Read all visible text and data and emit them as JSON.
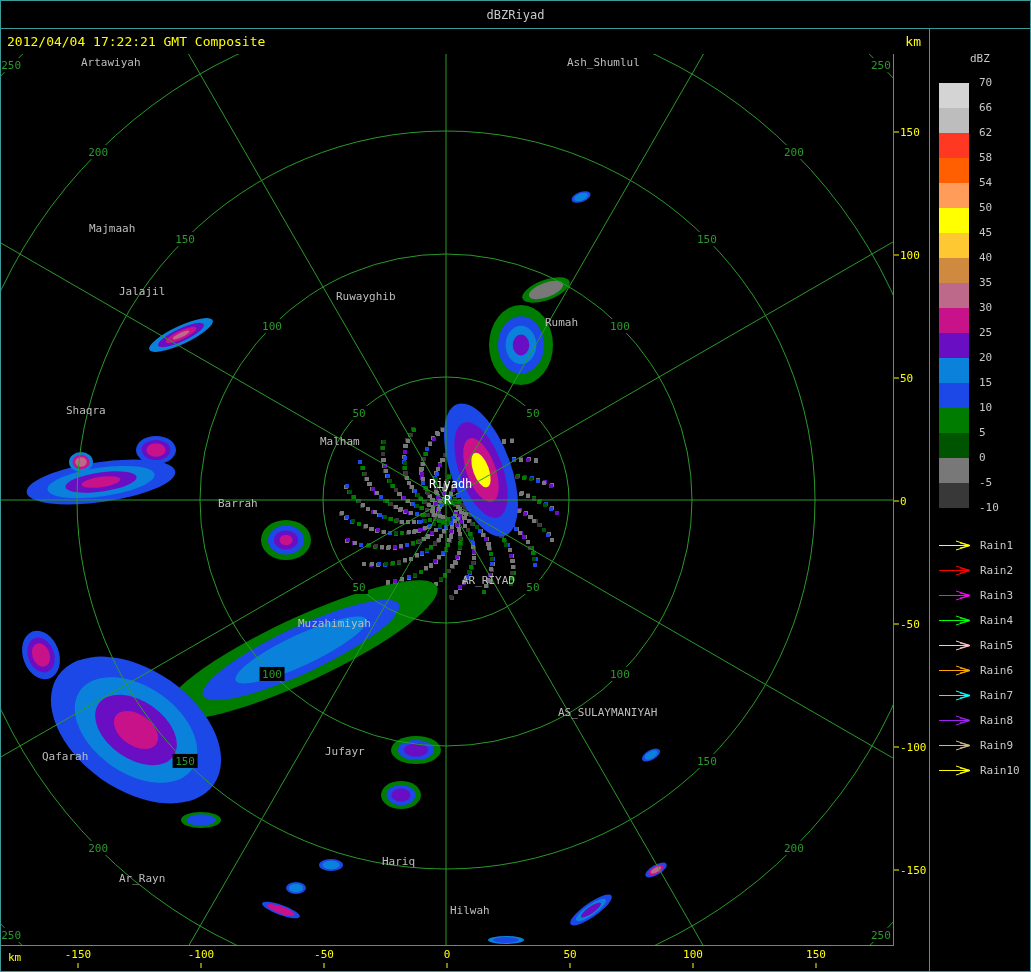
{
  "window": {
    "title": "dBZRiyad"
  },
  "header": {
    "timestamp": "2012/04/04 17:22:21 GMT Composite",
    "unit": "km"
  },
  "map": {
    "places": [
      {
        "name": "Artawiyah",
        "kind": "town"
      },
      {
        "name": "Ash_Shumlul",
        "kind": "town"
      },
      {
        "name": "Majmaah",
        "kind": "town"
      },
      {
        "name": "Jalajil",
        "kind": "town"
      },
      {
        "name": "Ruwayghib",
        "kind": "town"
      },
      {
        "name": "Rumah",
        "kind": "town"
      },
      {
        "name": "Shaqra",
        "kind": "town"
      },
      {
        "name": "Malham",
        "kind": "town"
      },
      {
        "name": "Riyadh",
        "kind": "radar_site"
      },
      {
        "name": "R",
        "kind": "radar_marker"
      },
      {
        "name": "Barrah",
        "kind": "town"
      },
      {
        "name": "AR_RIYAD",
        "kind": "town"
      },
      {
        "name": "Muzahimiyah",
        "kind": "town"
      },
      {
        "name": "AS_SULAYMANIYAH",
        "kind": "town"
      },
      {
        "name": "Qafarah",
        "kind": "town"
      },
      {
        "name": "Jufayr",
        "kind": "town"
      },
      {
        "name": "Hariq",
        "kind": "town"
      },
      {
        "name": "Ar_Rayn",
        "kind": "town"
      },
      {
        "name": "Hilwah",
        "kind": "town"
      }
    ],
    "ring_labels": [
      "50",
      "50",
      "50",
      "50",
      "100",
      "100",
      "100",
      "100",
      "150",
      "150",
      "150",
      "150",
      "200",
      "200",
      "200",
      "200",
      "250",
      "250",
      "250",
      "250"
    ]
  },
  "y_axis": {
    "ticks": [
      "150",
      "100",
      "50",
      "0",
      "-50",
      "-100",
      "-150"
    ]
  },
  "x_axis": {
    "unit": "km",
    "ticks": [
      "-150",
      "-100",
      "-50",
      "0",
      "50",
      "100",
      "150"
    ]
  },
  "legend": {
    "title": "dBZ",
    "bins": [
      {
        "label": "70",
        "color": "#d4d4d4"
      },
      {
        "label": "66",
        "color": "#bdbdbd"
      },
      {
        "label": "62",
        "color": "#ff3823"
      },
      {
        "label": "58",
        "color": "#ff5f00"
      },
      {
        "label": "54",
        "color": "#ff9c5a"
      },
      {
        "label": "50",
        "color": "#ffff00"
      },
      {
        "label": "45",
        "color": "#fdc832"
      },
      {
        "label": "40",
        "color": "#d08a40"
      },
      {
        "label": "35",
        "color": "#bd6a8a"
      },
      {
        "label": "30",
        "color": "#c8128a"
      },
      {
        "label": "25",
        "color": "#6a0ec3"
      },
      {
        "label": "20",
        "color": "#0a82dc"
      },
      {
        "label": "15",
        "color": "#1c48e8"
      },
      {
        "label": "10",
        "color": "#007c00"
      },
      {
        "label": "5",
        "color": "#005400"
      },
      {
        "label": "0",
        "color": "#787878"
      },
      {
        "label": "-5",
        "color": "#383838"
      }
    ],
    "bottom_label": "-10"
  },
  "tracks": [
    {
      "label": "Rain1",
      "color": "#ffff00"
    },
    {
      "label": "Rain2",
      "color": "#ff0000"
    },
    {
      "label": "Rain3",
      "color": "#ff00ff"
    },
    {
      "label": "Rain4",
      "color": "#00ff00"
    },
    {
      "label": "Rain5",
      "color": "#ffc0cb"
    },
    {
      "label": "Rain6",
      "color": "#ffa500"
    },
    {
      "label": "Rain7",
      "color": "#00ffff"
    },
    {
      "label": "Rain8",
      "color": "#a020f0"
    },
    {
      "label": "Rain9",
      "color": "#d2b48c"
    },
    {
      "label": "Rain10",
      "color": "#ffff00"
    }
  ]
}
